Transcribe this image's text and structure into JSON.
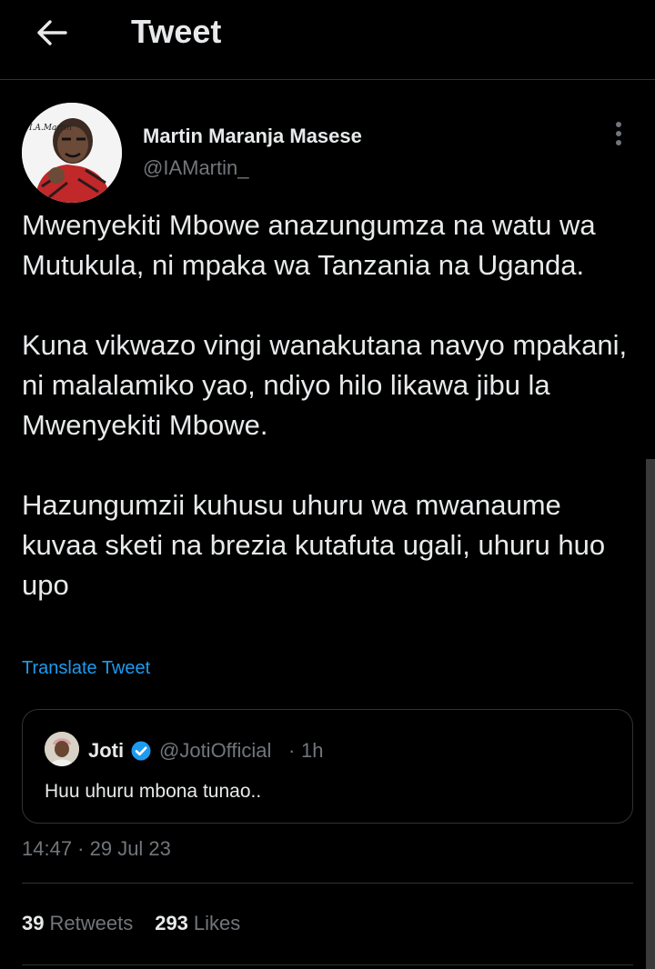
{
  "header": {
    "title": "Tweet",
    "back_icon": "arrow-left-icon"
  },
  "tweet": {
    "author_name": "Martin Maranja Masese",
    "author_handle": "@IAMartin_",
    "avatar_caption": "I.A.Martin",
    "more_icon": "more-vertical-icon",
    "paragraphs": [
      "Mwenyekiti Mbowe anazungumza na watu wa Mutukula, ni mpaka wa Tanzania na Uganda.",
      "Kuna vikwazo vingi wanakutana navyo mpakani, ni malalamiko yao, ndiyo hilo likawa jibu la Mwenyekiti Mbowe.",
      "Hazungumzii kuhusu uhuru wa mwanaume kuvaa sketi na brezia kutafuta ugali, uhuru huo upo"
    ],
    "translate_label": "Translate Tweet",
    "timestamp": "14:47 · 29 Jul 23"
  },
  "quote": {
    "name": "Joti",
    "verified_icon": "verified-badge-icon",
    "handle": "@JotiOfficial",
    "separator": "·",
    "time": "1h",
    "text": "Huu uhuru mbona tunao.."
  },
  "stats": {
    "retweets_count": "39",
    "retweets_label": "Retweets",
    "likes_count": "293",
    "likes_label": "Likes"
  },
  "colors": {
    "background": "#000000",
    "text_primary": "#e7e9ea",
    "text_secondary": "#71767b",
    "accent": "#1d9bf0",
    "border": "#2f3336"
  }
}
